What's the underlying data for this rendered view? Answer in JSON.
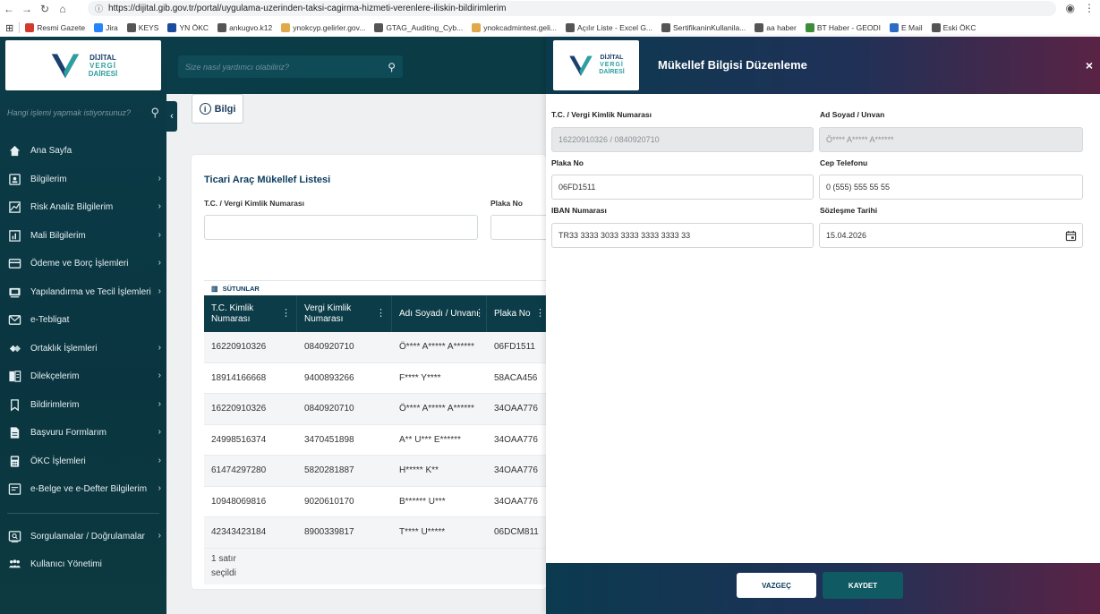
{
  "browser": {
    "url_host": "https://dijital.gib.gov.tr",
    "url_path": "/portal/uygulama-uzerinden-taksi-cagirma-hizmeti-verenlere-iliskin-bildirimlerim",
    "bookmarks": [
      "Resmi Gazete",
      "Jira",
      "KEYS",
      "YN ÖKC",
      "ankugvo.k12",
      "ynokcyp.gelirler.gov...",
      "GTAG_Auditing_Cyb...",
      "ynokcadmintest.geli...",
      "Açılır Liste - Excel G...",
      "SertifikaninKullanila...",
      "aa haber",
      "BT Haber - GEODI",
      "E Mail",
      "Eski ÖKC"
    ],
    "bookmark_colors": [
      "#d23a2b",
      "#2684ff",
      "#555555",
      "#1a4b9c",
      "#555555",
      "#e0a94a",
      "#555555",
      "#e0a94a",
      "#555555",
      "#555555",
      "#555555",
      "#3b8d3b",
      "#2b6cc4",
      "#555555"
    ]
  },
  "logo": {
    "line1": "DİJİTAL",
    "line2": "VERGİ",
    "line3": "DAİRESİ"
  },
  "sidebar": {
    "search_placeholder": "Hangi işlemi yapmak istiyorsunuz?",
    "items": [
      {
        "label": "Ana Sayfa",
        "icon": "home-icon",
        "chevron": false
      },
      {
        "label": "Bilgilerim",
        "icon": "id-card-icon",
        "chevron": true
      },
      {
        "label": "Risk Analiz Bilgilerim",
        "icon": "risk-analysis-icon",
        "chevron": true
      },
      {
        "label": "Mali Bilgilerim",
        "icon": "bar-chart-icon",
        "chevron": true
      },
      {
        "label": "Ödeme ve Borç İşlemleri",
        "icon": "credit-card-icon",
        "chevron": true
      },
      {
        "label": "Yapılandırma ve Tecil İşlemleri",
        "icon": "restructure-icon",
        "chevron": true
      },
      {
        "label": "e-Tebligat",
        "icon": "mail-icon",
        "chevron": false
      },
      {
        "label": "Ortaklık İşlemleri",
        "icon": "partnership-icon",
        "chevron": true
      },
      {
        "label": "Dilekçelerim",
        "icon": "petition-icon",
        "chevron": true
      },
      {
        "label": "Bildirimlerim",
        "icon": "bookmark-icon",
        "chevron": true
      },
      {
        "label": "Başvuru Formlarım",
        "icon": "form-icon",
        "chevron": true
      },
      {
        "label": "ÖKC İşlemleri",
        "icon": "cash-register-icon",
        "chevron": true
      },
      {
        "label": "e-Belge ve e-Defter Bilgilerim",
        "icon": "e-document-icon",
        "chevron": true
      }
    ],
    "bottom_items": [
      {
        "label": "Sorgulamalar / Doğrulamalar",
        "icon": "query-icon",
        "chevron": true
      },
      {
        "label": "Kullanıcı Yönetimi",
        "icon": "users-icon",
        "chevron": false
      }
    ]
  },
  "topbar": {
    "search_placeholder": "Size nasıl yardımcı olabiliriz?"
  },
  "bilgi_button": "Bilgi",
  "list": {
    "title": "Ticari Araç Mükellef Listesi",
    "filter_tc_label": "T.C. / Vergi Kimlik Numarası",
    "filter_plate_label": "Plaka No",
    "columns_label": "SÜTUNLAR",
    "headers": [
      "T.C. Kimlik Numarası",
      "Vergi Kimlik Numarası",
      "Adı Soyadı / Unvanı",
      "Plaka No"
    ],
    "rows": [
      [
        "16220910326",
        "0840920710",
        "Ö**** A***** A******",
        "06FD1511"
      ],
      [
        "18914166668",
        "9400893266",
        "F**** Y****",
        "58ACA456"
      ],
      [
        "16220910326",
        "0840920710",
        "Ö**** A***** A******",
        "34OAA776"
      ],
      [
        "24998516374",
        "3470451898",
        "A** U*** E******",
        "34OAA776"
      ],
      [
        "61474297280",
        "5820281887",
        "H***** K**",
        "34OAA776"
      ],
      [
        "10948069816",
        "9020610170",
        "B****** U***",
        "34OAA776"
      ],
      [
        "42343423184",
        "8900339817",
        "T**** U*****",
        "06DCM811"
      ]
    ],
    "footer_line1": "1 satır",
    "footer_line2": "seçildi"
  },
  "drawer": {
    "title": "Mükellef Bilgisi Düzenleme",
    "close": "×",
    "fields": {
      "tc_label": "T.C. / Vergi Kimlik Numarası",
      "tc_value": "16220910326 / 0840920710",
      "name_label": "Ad Soyad / Unvan",
      "name_value": "Ö**** A***** A******",
      "plate_label": "Plaka No",
      "plate_value": "06FD1511",
      "phone_label": "Cep Telefonu",
      "phone_value": "0 (555) 555 55 55",
      "iban_label": "IBAN Numarası",
      "iban_value": "TR33 3333 3033 3333 3333 3333 33",
      "date_label": "Sözleşme Tarihi",
      "date_value": "15.04.2026"
    },
    "cancel": "VAZGEÇ",
    "save": "KAYDET"
  }
}
